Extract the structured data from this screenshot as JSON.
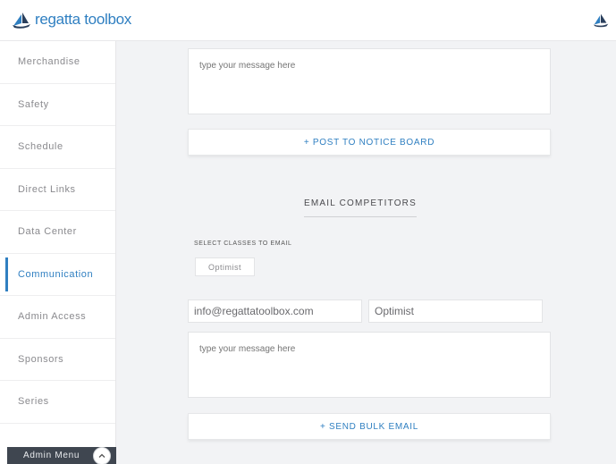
{
  "header": {
    "logo_text": "regatta toolbox",
    "logo_icon": "sailboat-icon",
    "avatar_icon": "sailboat-icon"
  },
  "sidebar": {
    "items": [
      {
        "label": "Merchandise"
      },
      {
        "label": "Safety"
      },
      {
        "label": "Schedule"
      },
      {
        "label": "Direct Links"
      },
      {
        "label": "Data Center"
      },
      {
        "label": "Communication",
        "active": true
      },
      {
        "label": "Admin Access"
      },
      {
        "label": "Sponsors"
      },
      {
        "label": "Series"
      }
    ],
    "admin_menu_label": "Admin Menu",
    "admin_menu_icon": "chevron-up-icon"
  },
  "notice": {
    "message_placeholder": "type your message here",
    "post_button": "+ POST TO NOTICE BOARD"
  },
  "email": {
    "section_title": "EMAIL COMPETITORS",
    "classes_label": "SELECT CLASSES TO EMAIL",
    "class_chip": "Optimist",
    "from_value": "info@regattatoolbox.com",
    "class_value": "Optimist",
    "message_placeholder": "type your message here",
    "send_button": "+ SEND BULK EMAIL"
  },
  "colors": {
    "accent": "#2f7fc1",
    "sidebar_text": "#8a8a8e",
    "admin_bar": "#3f4650",
    "background": "#f2f3f5"
  }
}
